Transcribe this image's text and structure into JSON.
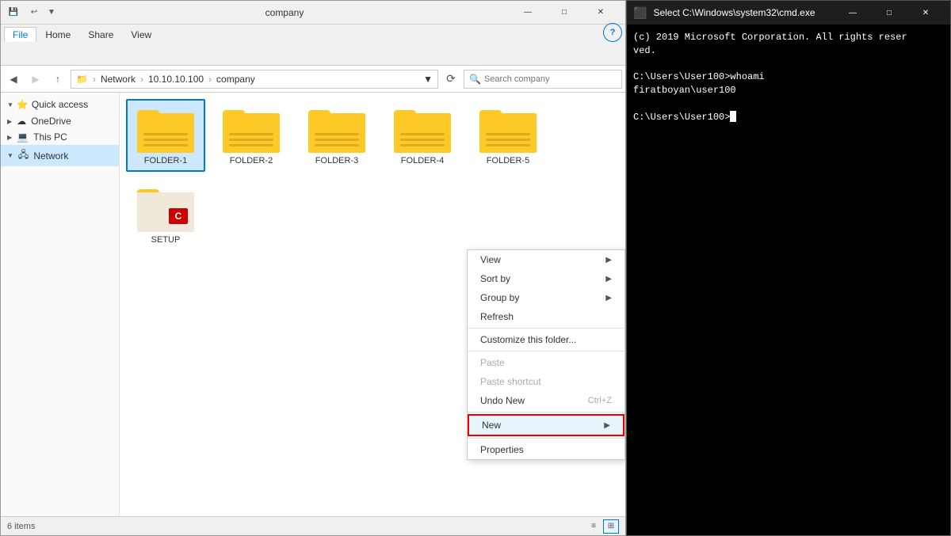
{
  "fileExplorer": {
    "title": "company",
    "titleBar": {
      "qatButtons": [
        "save-icon",
        "undo-icon",
        "redo-icon"
      ],
      "windowTitle": "company",
      "controls": [
        "minimize",
        "maximize",
        "close"
      ]
    },
    "ribbon": {
      "tabs": [
        "File",
        "Home",
        "Share",
        "View"
      ],
      "activeTab": "File"
    },
    "addressBar": {
      "path": [
        "Network",
        "10.10.10.100",
        "company"
      ],
      "searchPlaceholder": "Search company"
    },
    "sidebar": {
      "items": [
        {
          "label": "Quick access",
          "icon": "⭐",
          "type": "section"
        },
        {
          "label": "OneDrive",
          "icon": "☁",
          "type": "item"
        },
        {
          "label": "This PC",
          "icon": "💻",
          "type": "item"
        },
        {
          "label": "Network",
          "icon": "🖧",
          "type": "item",
          "active": true
        }
      ]
    },
    "files": [
      {
        "name": "FOLDER-1",
        "type": "folder",
        "selected": true
      },
      {
        "name": "FOLDER-2",
        "type": "folder"
      },
      {
        "name": "FOLDER-3",
        "type": "folder"
      },
      {
        "name": "FOLDER-4",
        "type": "folder"
      },
      {
        "name": "FOLDER-5",
        "type": "folder"
      },
      {
        "name": "SETUP",
        "type": "setup"
      }
    ],
    "statusBar": {
      "itemCount": "6 items"
    },
    "contextMenu": {
      "items": [
        {
          "label": "View",
          "hasArrow": true,
          "enabled": true
        },
        {
          "label": "Sort by",
          "hasArrow": true,
          "enabled": true
        },
        {
          "label": "Group by",
          "hasArrow": true,
          "enabled": true
        },
        {
          "label": "Refresh",
          "hasArrow": false,
          "enabled": true
        },
        {
          "separator": true
        },
        {
          "label": "Customize this folder...",
          "hasArrow": false,
          "enabled": true
        },
        {
          "separator": true
        },
        {
          "label": "Paste",
          "hasArrow": false,
          "enabled": false
        },
        {
          "label": "Paste shortcut",
          "hasArrow": false,
          "enabled": false
        },
        {
          "label": "Undo New",
          "hasArrow": false,
          "enabled": true,
          "shortcut": "Ctrl+Z"
        },
        {
          "separator": true
        },
        {
          "label": "New",
          "hasArrow": true,
          "enabled": true,
          "highlighted": true
        },
        {
          "separator": false
        },
        {
          "label": "Properties",
          "hasArrow": false,
          "enabled": true
        }
      ]
    }
  },
  "cmdWindow": {
    "title": "Select C:\\Windows\\system32\\cmd.exe",
    "lines": [
      "(c) 2019 Microsoft Corporation. All rights reser",
      "ved.",
      "",
      "C:\\Users\\User100>whoami",
      "firatboyan\\user100",
      "",
      "C:\\Users\\User100>"
    ]
  }
}
